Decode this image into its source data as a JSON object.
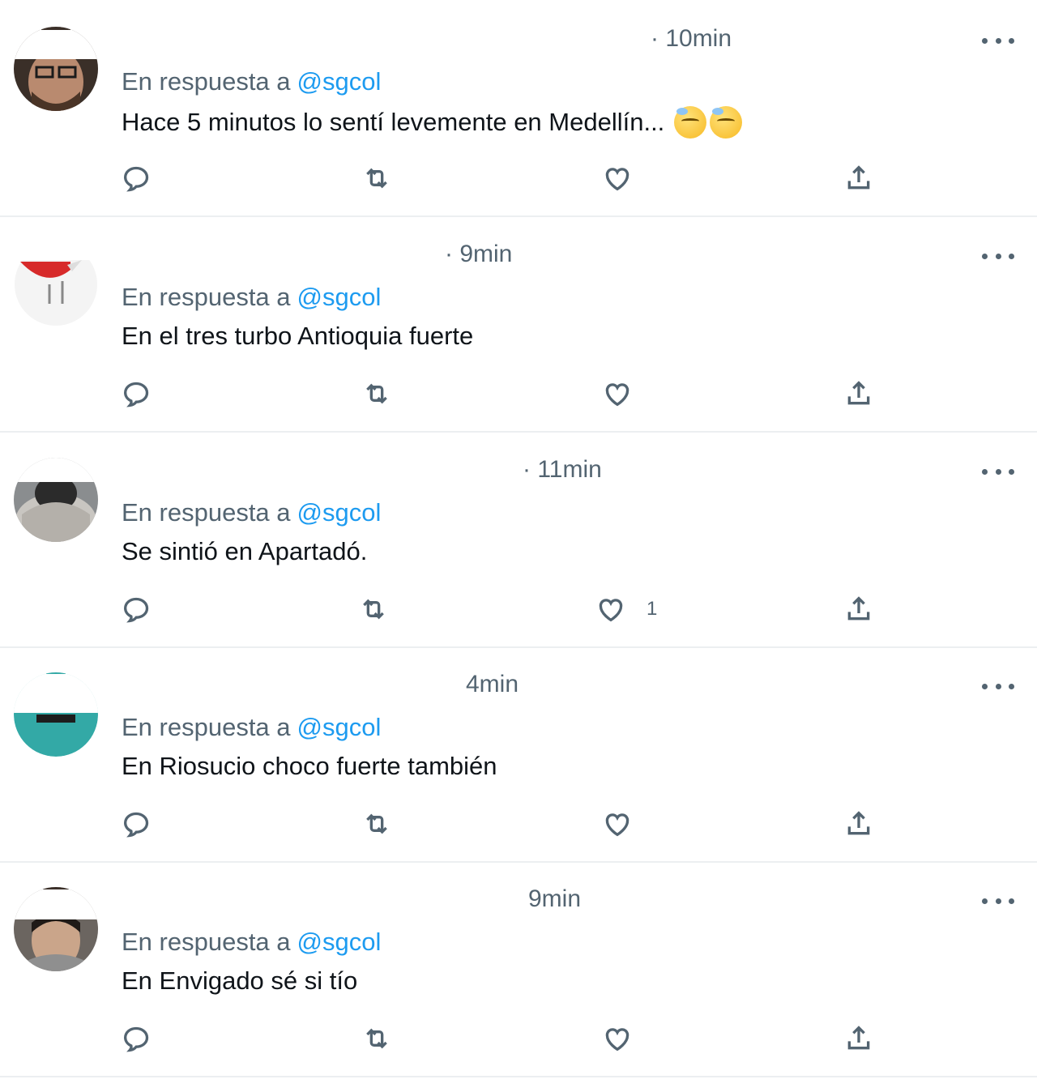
{
  "feed": {
    "tweets": [
      {
        "timestamp": "· 10min",
        "reply_prefix": "En respuesta a",
        "mention": "@sgcol",
        "text": "Hace 5 minutos lo sentí levemente en Medellín...",
        "emoji": [
          "downcast-sweat-face",
          "downcast-sweat-face"
        ],
        "like_count": "",
        "avatar": "person-glasses-beard"
      },
      {
        "timestamp": "· 9min",
        "reply_prefix": "En respuesta a",
        "mention": "@sgcol",
        "text": "En el tres turbo Antioquia fuerte",
        "emoji": [],
        "like_count": "",
        "avatar": "red-bird-cartoon"
      },
      {
        "timestamp": "· 11min",
        "reply_prefix": "En respuesta a",
        "mention": "@sgcol",
        "text": "Se sintió en Apartadó.",
        "emoji": [],
        "like_count": "1",
        "avatar": "person-hood-photo"
      },
      {
        "timestamp": "4min",
        "reply_prefix": "En respuesta a",
        "mention": "@sgcol",
        "text": "En Riosucio choco fuerte también",
        "emoji": [],
        "like_count": "",
        "avatar": "teal-graphic"
      },
      {
        "timestamp": "9min",
        "reply_prefix": "En respuesta a",
        "mention": "@sgcol",
        "text": "En Envigado sé si tío",
        "emoji": [],
        "like_count": "",
        "avatar": "person-photo"
      }
    ]
  },
  "icons": {
    "reply": "reply-icon",
    "retweet": "retweet-icon",
    "like": "heart-icon",
    "share": "share-icon",
    "more": "more-icon"
  },
  "colors": {
    "secondary_text": "#536471",
    "mention": "#1d9bf0",
    "divider": "#eceff1"
  }
}
